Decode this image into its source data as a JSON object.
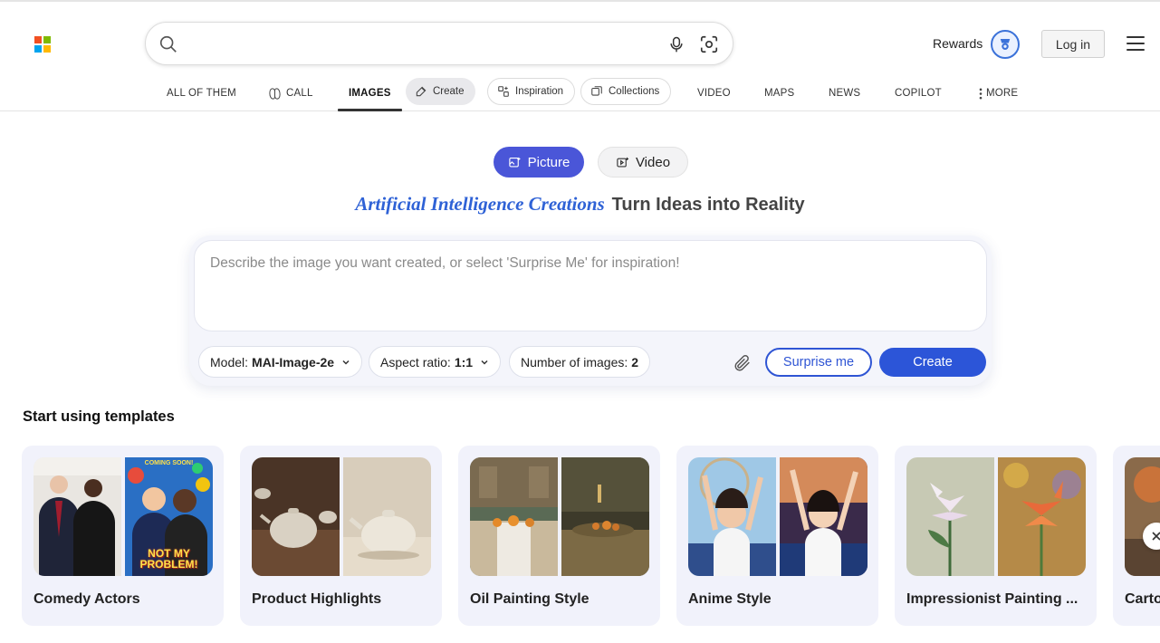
{
  "header": {
    "search_placeholder": "",
    "rewards_label": "Rewards",
    "login_label": "Log in",
    "logo_colors": [
      "#f25022",
      "#7fba00",
      "#00a4ef",
      "#ffb900"
    ]
  },
  "nav": {
    "items": [
      {
        "label": "ALL OF THEM",
        "icon": null,
        "active": false
      },
      {
        "label": "CALL",
        "icon": "copilot-icon",
        "active": false
      },
      {
        "label": "IMAGES",
        "icon": null,
        "active": true
      },
      {
        "label": "Create",
        "icon": "create-icon",
        "active": false
      },
      {
        "label": "Inspiration",
        "icon": "inspiration-icon",
        "active": false
      },
      {
        "label": "Collections",
        "icon": "collections-icon",
        "active": false
      },
      {
        "label": "VIDEO",
        "icon": null,
        "active": false
      },
      {
        "label": "MAPS",
        "icon": null,
        "active": false
      },
      {
        "label": "NEWS",
        "icon": null,
        "active": false
      },
      {
        "label": "COPILOT",
        "icon": null,
        "active": false
      },
      {
        "label": "MORE",
        "icon": "more-vertical-icon",
        "active": false
      }
    ]
  },
  "mode": {
    "picture_label": "Picture",
    "video_label": "Video",
    "selected": "Picture"
  },
  "headline": {
    "accent": "Artificial Intelligence Creations",
    "main": "Turn Ideas into Reality"
  },
  "prompt": {
    "placeholder": "Describe the image you want created, or select 'Surprise Me' for inspiration!",
    "value": "",
    "model_label": "Model:",
    "model_value": "MAI-Image-2e",
    "aspect_label": "Aspect ratio:",
    "aspect_value": "1:1",
    "count_label": "Number of images:",
    "count_value": "2",
    "surprise_label": "Surprise me",
    "create_label": "Create"
  },
  "templates": {
    "title": "Start using templates",
    "cards": [
      {
        "label": "Comedy Actors",
        "poster_top": "COMING SOON!",
        "poster_bottom": "NOT MY PROBLEM!"
      },
      {
        "label": "Product Highlights"
      },
      {
        "label": "Oil Painting Style"
      },
      {
        "label": "Anime Style"
      },
      {
        "label": "Impressionist Painting ..."
      },
      {
        "label": "Carto"
      }
    ]
  },
  "colors": {
    "accent_blue": "#2c55d8",
    "picture_button": "#4a56d8",
    "headline_accent": "#2f62d6"
  }
}
